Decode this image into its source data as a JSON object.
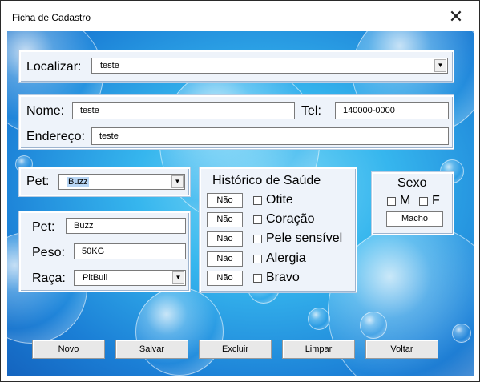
{
  "window": {
    "title": "Ficha de Cadastro",
    "close_glyph": "✕"
  },
  "search": {
    "label": "Localizar:",
    "value": "teste"
  },
  "contact": {
    "name_label": "Nome:",
    "name_value": "teste",
    "tel_label": "Tel:",
    "tel_value": "140000-0000",
    "address_label": "Endereço:",
    "address_value": "teste"
  },
  "pet_select": {
    "label": "Pet:",
    "value": "Buzz"
  },
  "pet_details": {
    "pet_label": "Pet:",
    "pet_value": "Buzz",
    "weight_label": "Peso:",
    "weight_value": "50KG",
    "breed_label": "Raça:",
    "breed_value": "PitBull"
  },
  "health": {
    "title": "Histórico de Saúde",
    "items": [
      {
        "value": "Não",
        "label": "Otite"
      },
      {
        "value": "Não",
        "label": "Coração"
      },
      {
        "value": "Não",
        "label": "Pele sensível"
      },
      {
        "value": "Não",
        "label": "Alergia"
      },
      {
        "value": "Não",
        "label": "Bravo"
      }
    ]
  },
  "sex": {
    "title": "Sexo",
    "m_label": "M",
    "f_label": "F",
    "value": "Macho"
  },
  "buttons": {
    "new": "Novo",
    "save": "Salvar",
    "delete": "Excluir",
    "clear": "Limpar",
    "back": "Voltar"
  },
  "icons": {
    "dropdown": "chevron-down-icon",
    "close": "close-icon"
  },
  "colors": {
    "background_top": "#7fd9f6",
    "background_bottom": "#1464bf",
    "panel": "#eef3fa",
    "selection": "#b8d6f5"
  }
}
